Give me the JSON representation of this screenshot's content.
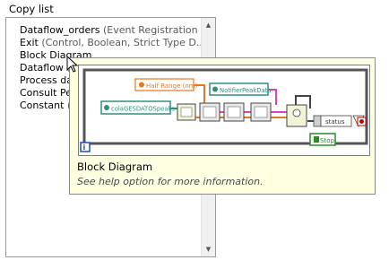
{
  "window": {
    "title": "Copy list"
  },
  "list": {
    "items": [
      {
        "name": "Dataflow_orders",
        "detail": " (Event Registration r..."
      },
      {
        "name": "Exit",
        "detail": " (Control, Boolean, Strict Type D..."
      },
      {
        "name": "Block  Diagram",
        "detail": ""
      },
      {
        "name": "Dataflow",
        "detail": " ("
      },
      {
        "name": "Process  da",
        "detail": ""
      },
      {
        "name": "Consult  Pe",
        "detail": ""
      },
      {
        "name": "Constant",
        "detail": " ("
      }
    ]
  },
  "tooltip": {
    "title": "Block  Diagram",
    "help": "See  help  option  for  more  information.",
    "diagram": {
      "labels": {
        "half_range": "Half Range (nm)",
        "notifier": "NotifierPeakData",
        "cola": "colaGESDATOSpeaks",
        "status": "status",
        "stop": "Stop"
      },
      "colors": {
        "orange": "#e8761e",
        "teal": "#2f8f7f",
        "green": "#2d8a2d",
        "pink": "#e040c0",
        "frame": "#555555",
        "wire": "#444444"
      }
    }
  }
}
